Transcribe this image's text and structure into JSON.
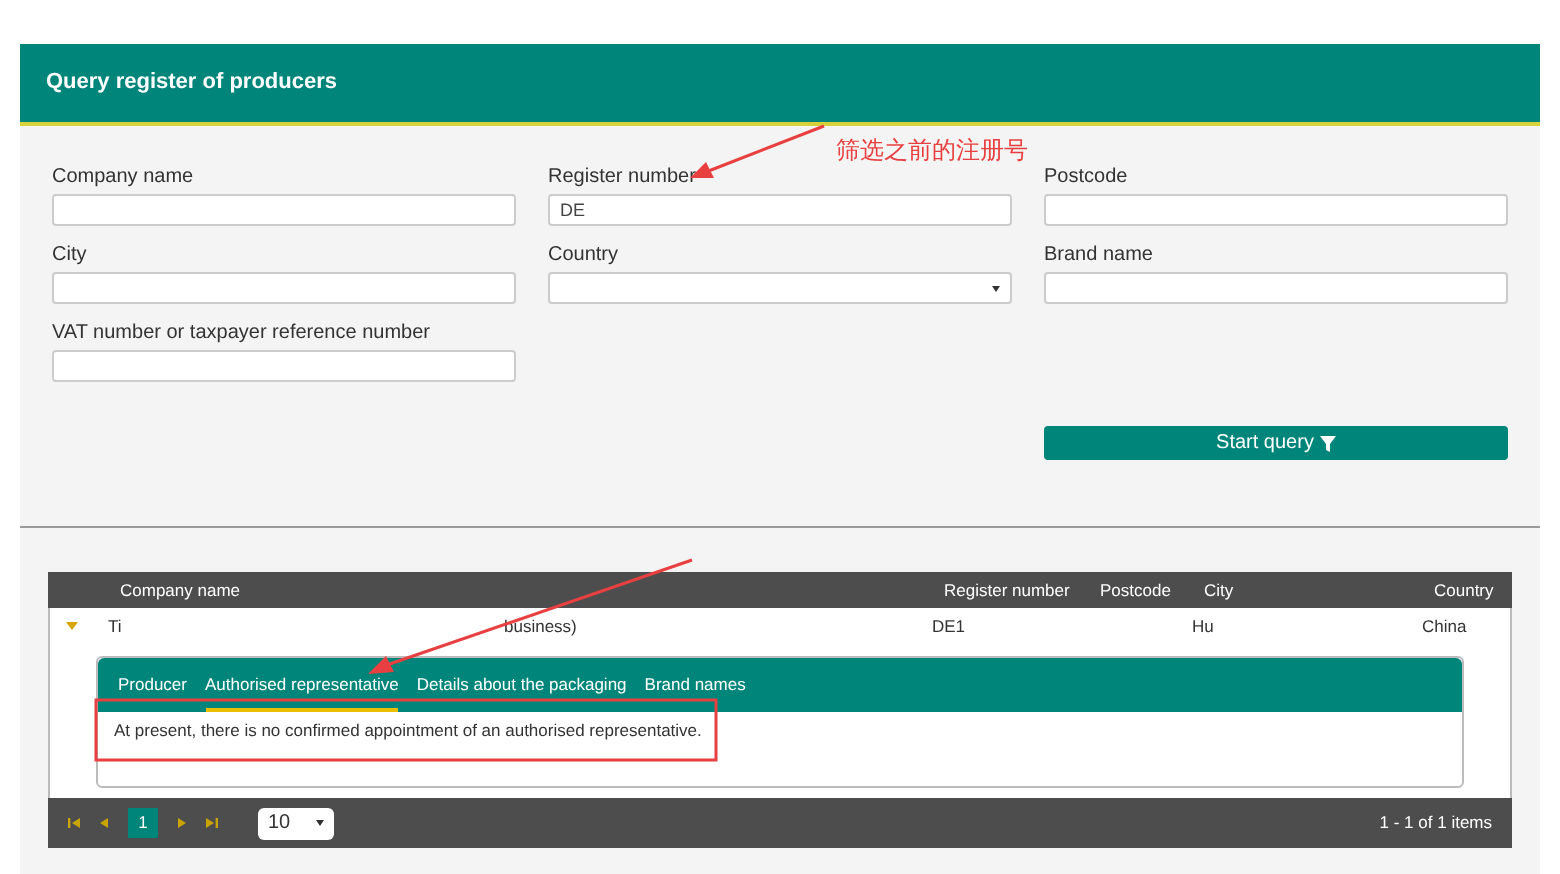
{
  "header": {
    "title": "Query register of producers"
  },
  "fields": [
    {
      "label": "Company name",
      "kind": "text"
    },
    {
      "label": "Register number",
      "kind": "text",
      "value": "DE"
    },
    {
      "label": "Postcode",
      "kind": "text"
    },
    {
      "label": "City",
      "kind": "text"
    },
    {
      "label": "Country",
      "kind": "select"
    },
    {
      "label": "Brand name",
      "kind": "text"
    },
    {
      "label": "VAT number or taxpayer reference number",
      "kind": "text"
    }
  ],
  "query_button": {
    "label": "Start query"
  },
  "table": {
    "columns": [
      "Company name",
      "Register number",
      "Postcode",
      "City",
      "Country"
    ],
    "rows": [
      {
        "expanded": true,
        "cells": [
          [
            "Ti",
            "business)"
          ],
          "DE1",
          "",
          "Hu",
          "China"
        ]
      }
    ]
  },
  "detail": {
    "tabs": [
      {
        "label": "Producer",
        "selected": false
      },
      {
        "label": "Authorised representative",
        "selected": true
      },
      {
        "label": "Details about the packaging",
        "selected": false
      },
      {
        "label": "Brand names",
        "selected": false
      }
    ],
    "message": "At present, there is no confirmed appointment of an authorised representative."
  },
  "pager": {
    "pages": [
      {
        "label": "1",
        "selected": true
      }
    ],
    "page_size": "10",
    "summary": "1 - 1 of 1 items"
  },
  "annotation": {
    "note": "筛选之前的注册号"
  }
}
